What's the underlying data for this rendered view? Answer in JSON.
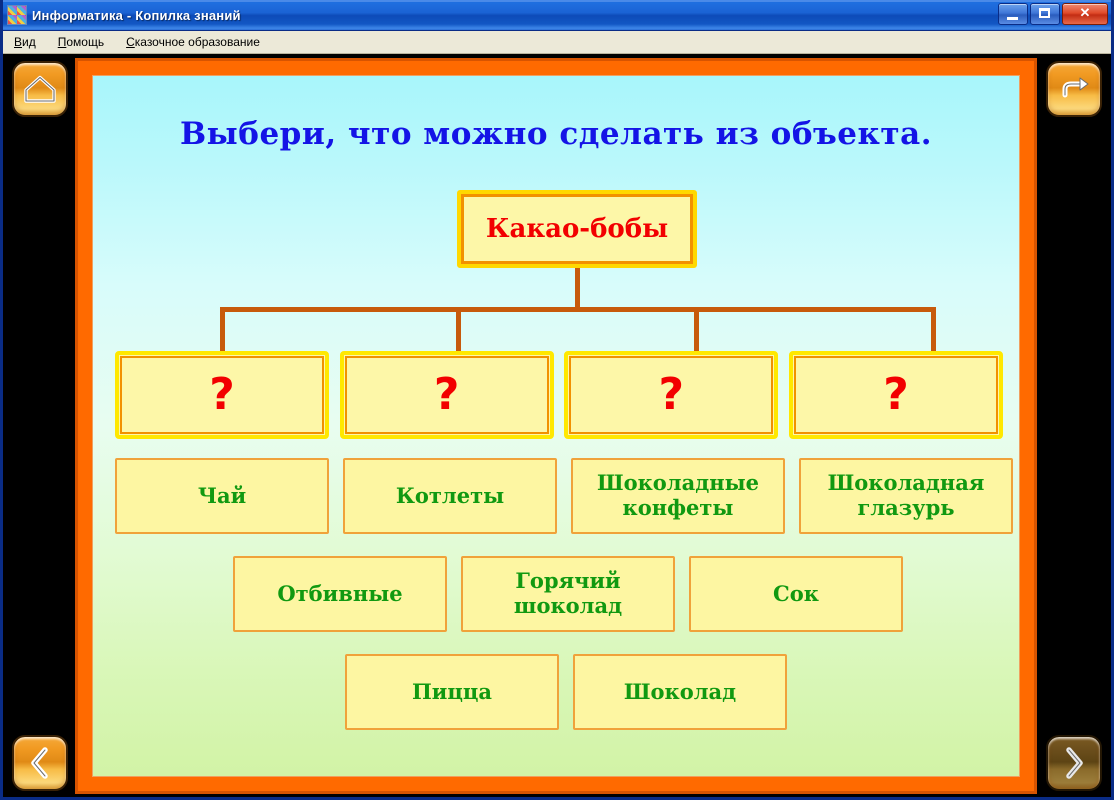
{
  "window": {
    "title": "Информатика - Копилка знаний",
    "icon": "app-icon",
    "buttons": {
      "minimize_label": "—",
      "maximize_label": "□",
      "close_label": "✕"
    }
  },
  "menu": {
    "items": [
      {
        "accesskey": "В",
        "rest": "ид"
      },
      {
        "accesskey": "П",
        "rest": "омощь"
      },
      {
        "accesskey": "С",
        "rest": "казочное образование"
      }
    ]
  },
  "nav": {
    "home": {
      "name": "home-button",
      "icon": "home-icon"
    },
    "exit": {
      "name": "exit-button",
      "icon": "exit-arrow-icon"
    },
    "prev": {
      "name": "previous-button",
      "icon": "chevron-left-icon"
    },
    "next": {
      "name": "next-button",
      "icon": "chevron-right-icon",
      "state": "dimmed"
    }
  },
  "slide": {
    "title": "Выбери, что можно сделать из объекта.",
    "root_node": "Какао-бобы",
    "question_slots": [
      {
        "label": "?"
      },
      {
        "label": "?"
      },
      {
        "label": "?"
      },
      {
        "label": "?"
      }
    ],
    "answer_rows": [
      [
        {
          "label": "Чай"
        },
        {
          "label": "Котлеты"
        },
        {
          "label": "Шоколадные конфеты"
        },
        {
          "label": "Шоколадная глазурь"
        }
      ],
      [
        {
          "label": "Отбивные"
        },
        {
          "label": "Горячий шоколад"
        },
        {
          "label": "Сок"
        }
      ],
      [
        {
          "label": "Пицца"
        },
        {
          "label": "Шоколад"
        }
      ]
    ]
  },
  "colors": {
    "title_blue": "#1414e6",
    "root_red": "#f20000",
    "answer_green": "#119911",
    "frame_orange": "#ff6a00",
    "connector_brown": "#c75a0c",
    "box_yellow": "#fdf7a8",
    "titlebar_blue": "#1b63d4"
  }
}
